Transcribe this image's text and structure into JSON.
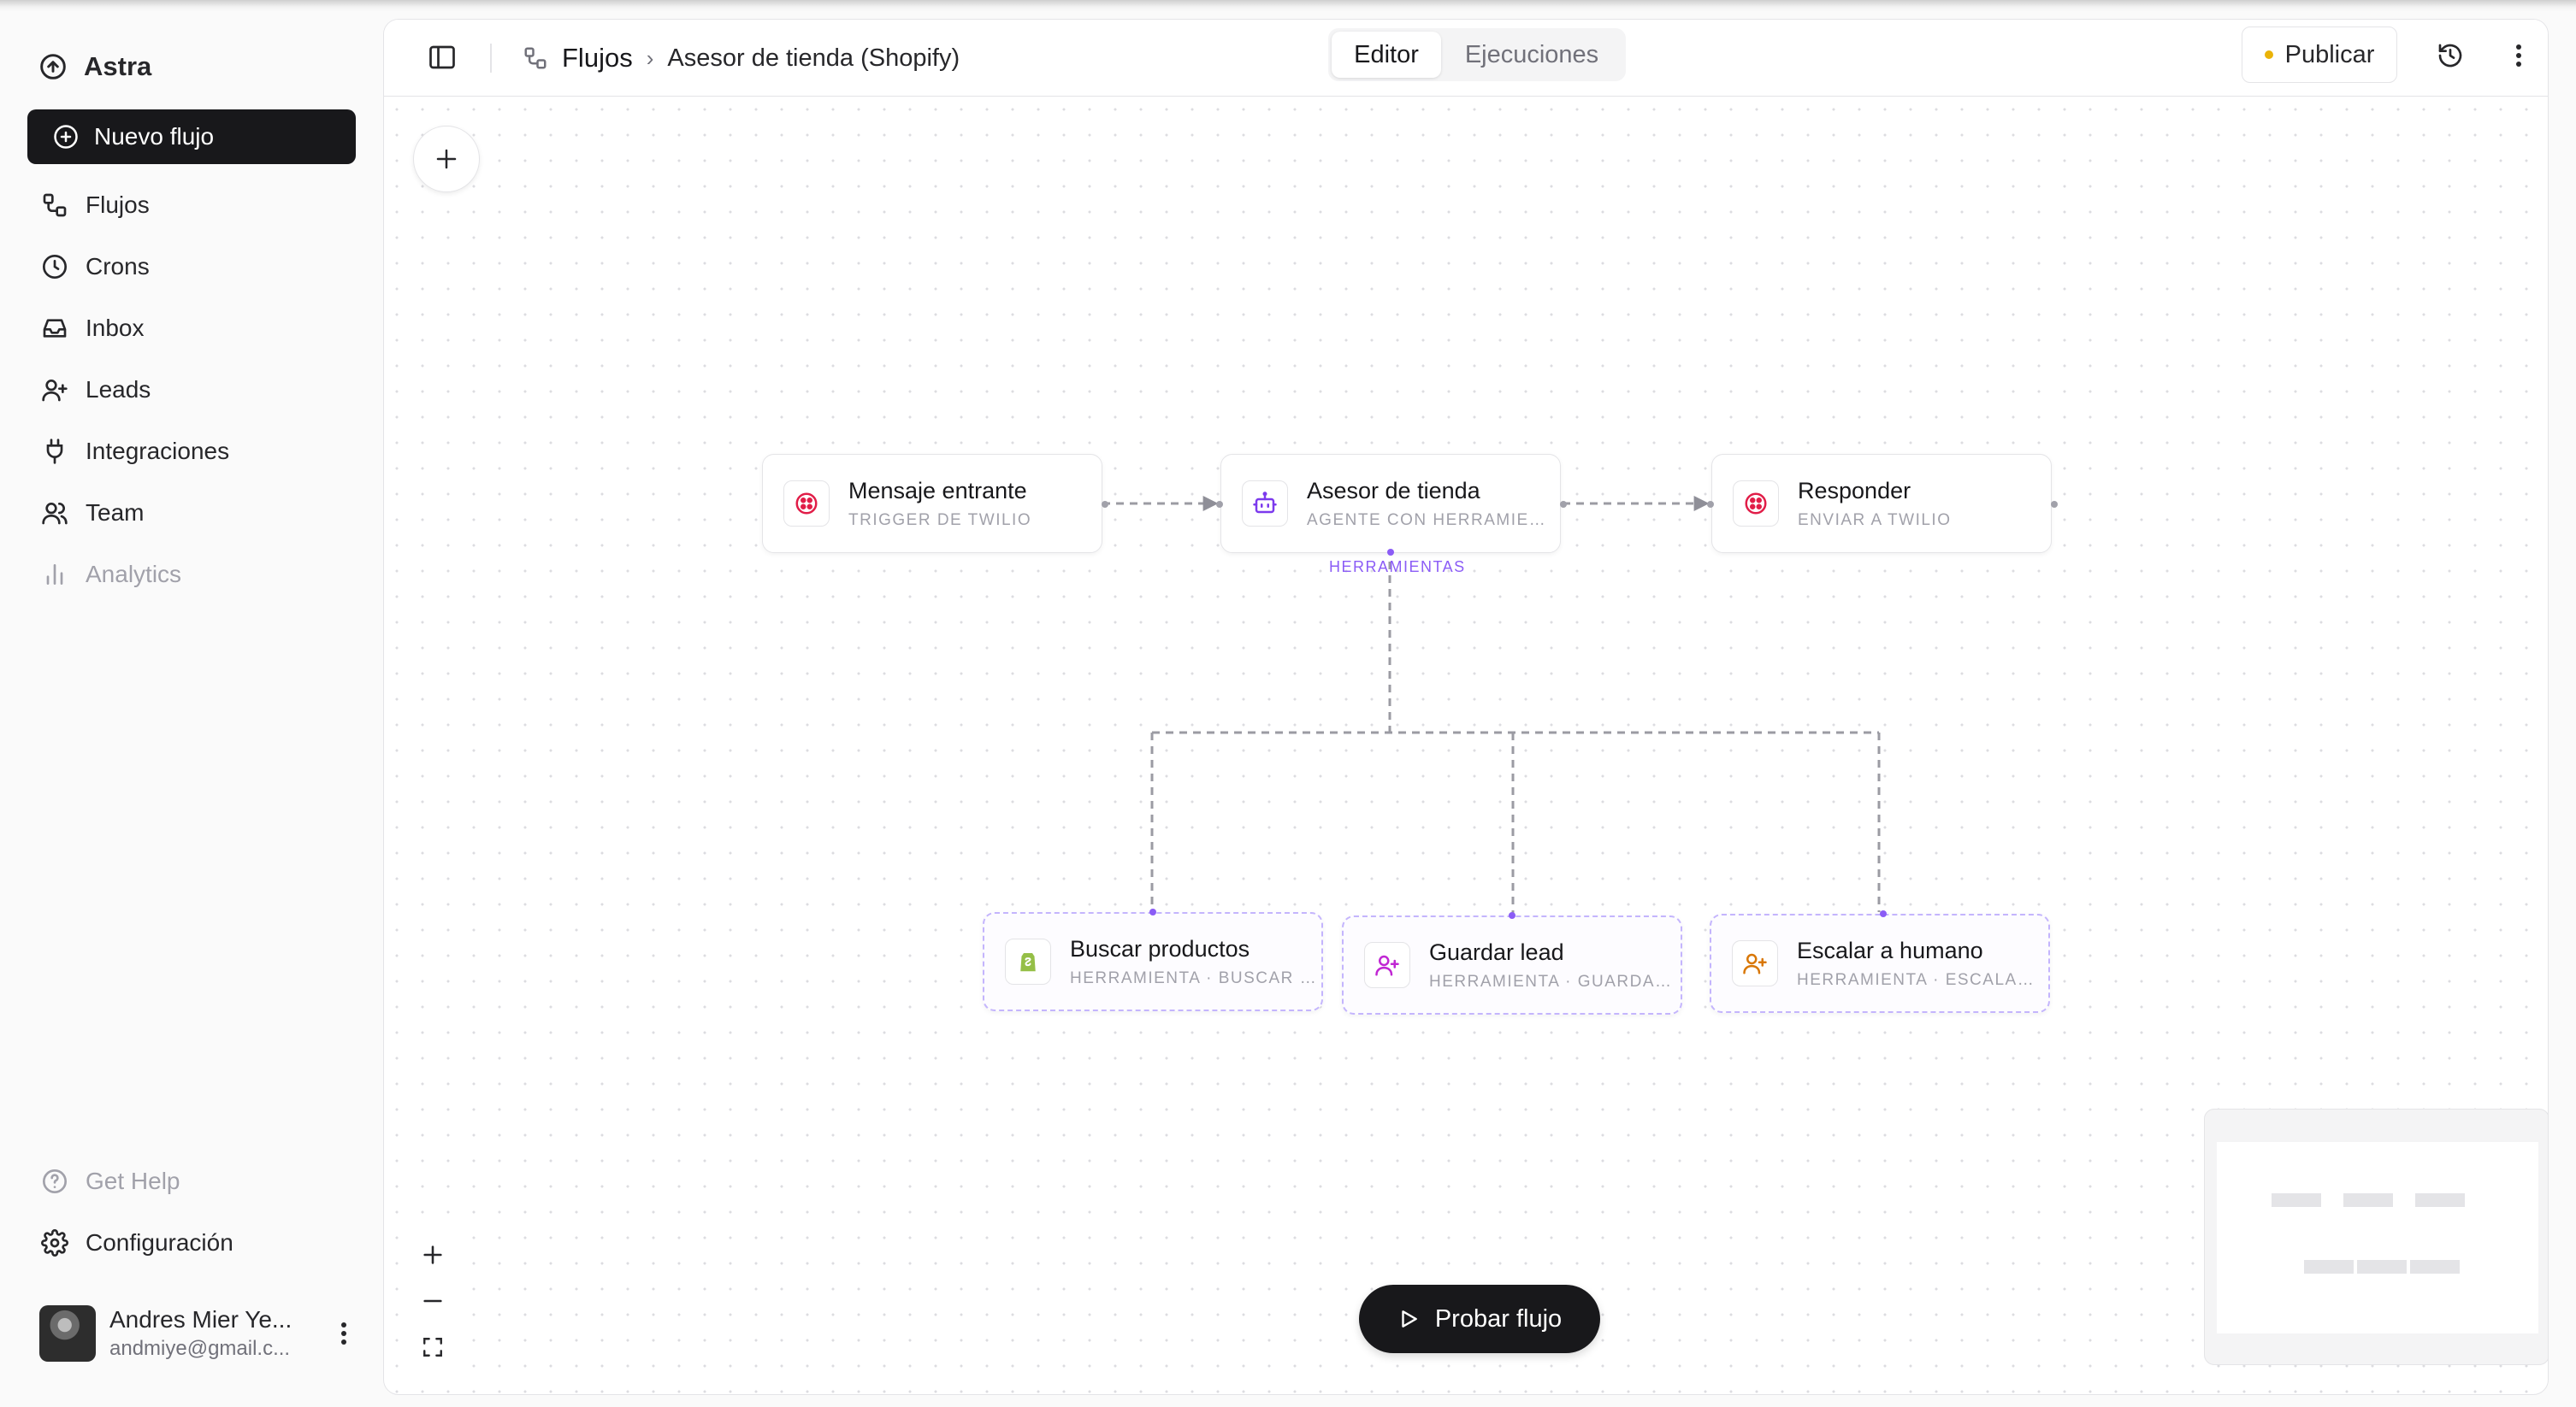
{
  "brand": {
    "name": "Astra"
  },
  "sidebar": {
    "new_flow_label": "Nuevo flujo",
    "items": [
      {
        "label": "Flujos",
        "icon": "workflow-icon"
      },
      {
        "label": "Crons",
        "icon": "clock-icon"
      },
      {
        "label": "Inbox",
        "icon": "inbox-icon"
      },
      {
        "label": "Leads",
        "icon": "user-plus-icon"
      },
      {
        "label": "Integraciones",
        "icon": "plug-icon"
      },
      {
        "label": "Team",
        "icon": "users-icon"
      },
      {
        "label": "Analytics",
        "icon": "bar-chart-icon"
      }
    ],
    "help_label": "Get Help",
    "settings_label": "Configuración"
  },
  "user": {
    "name": "Andres Mier Ye...",
    "email": "andmiye@gmail.c..."
  },
  "header": {
    "breadcrumb_root": "Flujos",
    "breadcrumb_separator": "›",
    "breadcrumb_current": "Asesor de tienda (Shopify)",
    "tabs": [
      {
        "label": "Editor",
        "active": true
      },
      {
        "label": "Ejecuciones",
        "active": false
      }
    ],
    "publish_label": "Publicar",
    "publish_status_color": "#eab308"
  },
  "canvas": {
    "nodes": {
      "incoming": {
        "title": "Mensaje entrante",
        "subtitle": "TRIGGER DE TWILIO",
        "icon": "twilio-icon",
        "color": "#e11d48"
      },
      "agent": {
        "title": "Asesor de tienda",
        "subtitle": "AGENTE CON HERRAMIEN...",
        "icon": "bot-icon",
        "color": "#7c3aed"
      },
      "respond": {
        "title": "Responder",
        "subtitle": "ENVIAR A TWILIO",
        "icon": "twilio-icon",
        "color": "#e11d48"
      },
      "tool_search": {
        "title": "Buscar productos",
        "subtitle": "HERRAMIENTA · BUSCAR P...",
        "icon": "shopify-icon",
        "color": "#95bf47"
      },
      "tool_lead": {
        "title": "Guardar lead",
        "subtitle": "HERRAMIENTA · GUARDAR...",
        "icon": "user-plus-icon",
        "color": "#c026d3"
      },
      "tool_escalate": {
        "title": "Escalar a humano",
        "subtitle": "HERRAMIENTA · ESCALAR ...",
        "icon": "user-plus-icon",
        "color": "#d97706"
      }
    },
    "tools_label": "HERRAMIENTAS",
    "run_label": "Probar flujo"
  }
}
